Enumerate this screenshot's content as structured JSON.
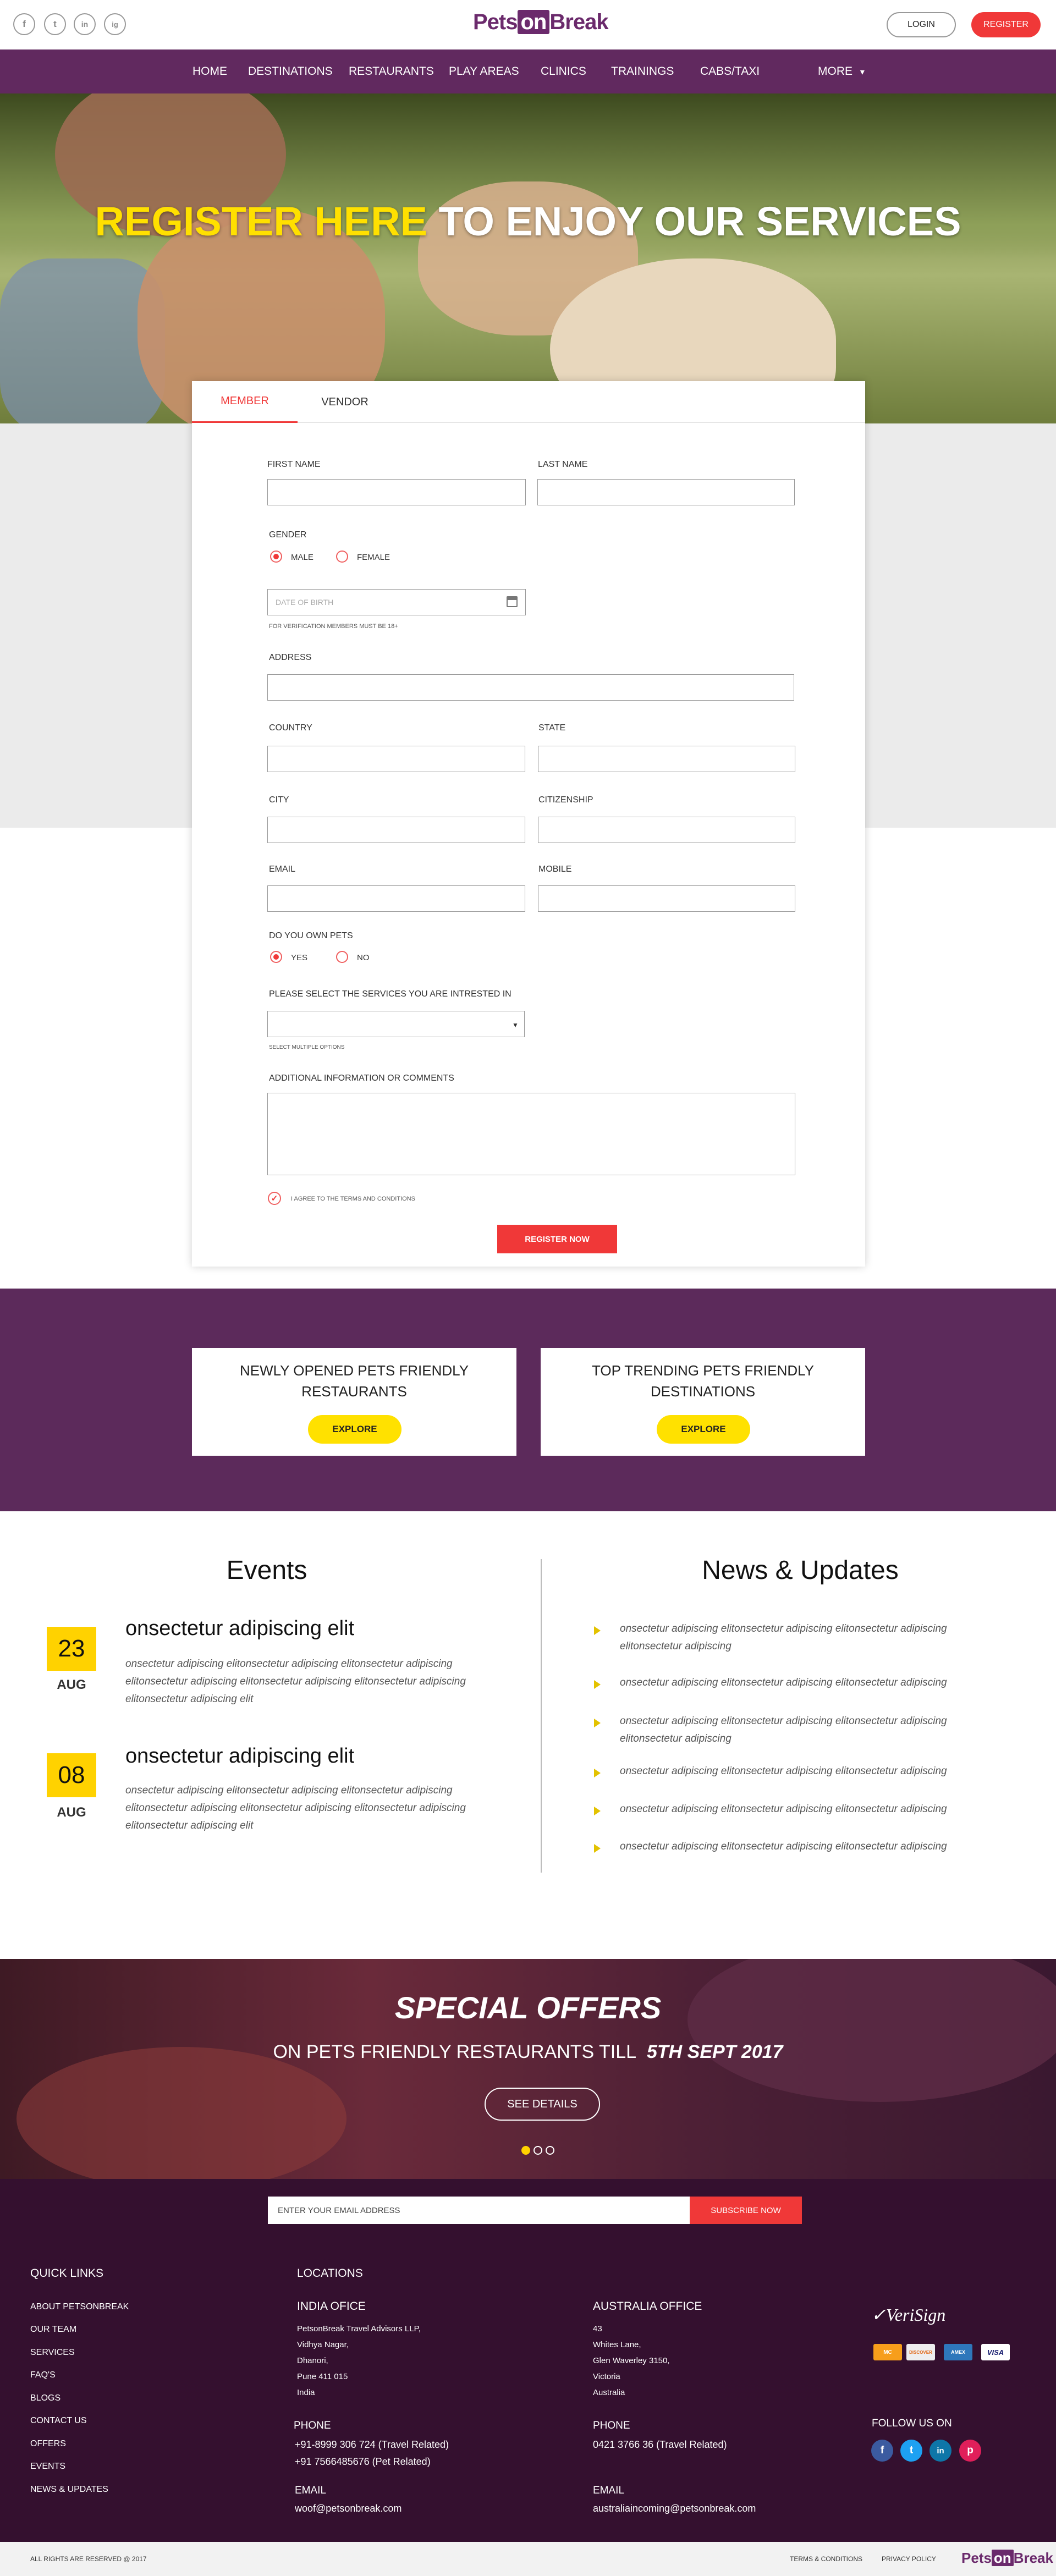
{
  "header": {
    "social": [
      "f",
      "t",
      "in",
      "ig"
    ],
    "logo": {
      "pre": "Pets",
      "mid": "on",
      "post": "Break"
    },
    "login": "LOGIN",
    "register": "REGISTER"
  },
  "nav": {
    "items": [
      "HOME",
      "DESTINATIONS",
      "RESTAURANTS",
      "PLAY AREAS",
      "CLINICS",
      "TRAININGS",
      "CABS/TAXI"
    ],
    "more": "MORE",
    "more_arrow": "▾"
  },
  "hero": {
    "highlight": "REGISTER HERE",
    "rest": " TO ENJOY OUR SERVICES"
  },
  "form": {
    "tabs": [
      "MEMBER",
      "VENDOR"
    ],
    "first_name": "FIRST NAME",
    "last_name": "LAST NAME",
    "gender": "GENDER",
    "male": "MALE",
    "female": "FEMALE",
    "dob_placeholder": "DATE OF BIRTH",
    "dob_note": "FOR VERIFICATION MEMBERS MUST BE 18+",
    "address": "ADDRESS",
    "country": "COUNTRY",
    "state": "STATE",
    "city": "CITY",
    "citizenship": "CITIZENSHIP",
    "email": "EMAIL",
    "mobile": "MOBILE",
    "own_pets": "DO YOU OWN PETS",
    "yes": "YES",
    "no": "NO",
    "services": "PLEASE SELECT THE SERVICES YOU ARE INTRESTED IN",
    "services_note": "SELECT MULTIPLE OPTIONS",
    "additional": "ADDITIONAL INFORMATION OR COMMENTS",
    "terms": "I AGREE TO THE TERMS AND CONDITIONS",
    "submit": "REGISTER NOW"
  },
  "promos": [
    {
      "line1": "NEWLY OPENED PETS FRIENDLY",
      "line2": "RESTAURANTS",
      "button": "EXPLORE"
    },
    {
      "line1": "TOP TRENDING PETS FRIENDLY",
      "line2": "DESTINATIONS",
      "button": "EXPLORE"
    }
  ],
  "events": {
    "title": "Events",
    "items": [
      {
        "day": "23",
        "month": "AUG",
        "title": "onsectetur adipiscing elit",
        "body": "onsectetur adipiscing elitonsectetur adipiscing elitonsectetur adipiscing elitonsectetur adipiscing elitonsectetur adipiscing elitonsectetur adipiscing elitonsectetur adipiscing elit"
      },
      {
        "day": "08",
        "month": "AUG",
        "title": "onsectetur adipiscing elit",
        "body": "onsectetur adipiscing elitonsectetur adipiscing elitonsectetur adipiscing elitonsectetur adipiscing elitonsectetur adipiscing elitonsectetur adipiscing elitonsectetur adipiscing elit"
      }
    ]
  },
  "news": {
    "title": "News & Updates",
    "items": [
      "onsectetur adipiscing elitonsectetur adipiscing elitonsectetur adipiscing elitonsectetur adipiscing",
      "onsectetur adipiscing elitonsectetur adipiscing elitonsectetur adipiscing",
      "onsectetur adipiscing elitonsectetur adipiscing elitonsectetur adipiscing elitonsectetur adipiscing",
      "onsectetur adipiscing elitonsectetur adipiscing elitonsectetur adipiscing",
      "onsectetur adipiscing elitonsectetur adipiscing elitonsectetur adipiscing",
      "onsectetur adipiscing elitonsectetur adipiscing elitonsectetur adipiscing"
    ]
  },
  "offers": {
    "title": "SPECIAL OFFERS",
    "subtitle": "ON PETS FRIENDLY RESTAURANTS TILL",
    "date": "5TH SEPT 2017",
    "button": "SEE DETAILS",
    "slides": 3
  },
  "footer": {
    "email_placeholder": "ENTER YOUR EMAIL ADDRESS",
    "subscribe": "SUBSCRIBE NOW",
    "quick_links_title": "QUICK LINKS",
    "quick_links": [
      "ABOUT PETSONBREAK",
      "OUR TEAM",
      "SERVICES",
      "FAQ'S",
      "BLOGS",
      "CONTACT US",
      "OFFERS",
      "EVENTS",
      "NEWS & UPDATES"
    ],
    "locations_title": "LOCATIONS",
    "india": {
      "title": "INDIA OFICE",
      "address": [
        "PetsonBreak Travel Advisors LLP,",
        "Vidhya Nagar,",
        "Dhanori,",
        "Pune 411 015",
        "India"
      ],
      "phone_label": "PHONE",
      "phones": [
        "+91-8999 306 724 (Travel Related)",
        "+91 7566485676 (Pet Related)"
      ],
      "email_label": "EMAIL",
      "email": "woof@petsonbreak.com"
    },
    "australia": {
      "title": "AUSTRALIA OFFICE",
      "address": [
        "43",
        "Whites Lane,",
        "Glen Waverley 3150,",
        "Victoria",
        "Australia"
      ],
      "phone_label": "PHONE",
      "phones": [
        "0421 3766 36 (Travel Related)"
      ],
      "email_label": "EMAIL",
      "email": "australiaincoming@petsonbreak.com"
    },
    "verisign": "VeriSign",
    "cards": [
      "MC",
      "DISCOVER",
      "AMEX",
      "VISA"
    ],
    "follow": "FOLLOW US ON",
    "follow_icons": [
      "f",
      "t",
      "in",
      "p"
    ]
  },
  "bottom": {
    "copyright": "ALL RIGHTS ARE RESERVED @ 2017",
    "terms": "TERMS & CONDITIONS",
    "privacy": "PRIVACY  POLICY",
    "logo": {
      "pre": "Pets",
      "mid": "on",
      "post": "Break"
    }
  },
  "colors": {
    "brand_purple": "#61295f",
    "accent_red": "#f03838",
    "accent_yellow": "#ffe000",
    "footer_bg": "#34102f"
  }
}
